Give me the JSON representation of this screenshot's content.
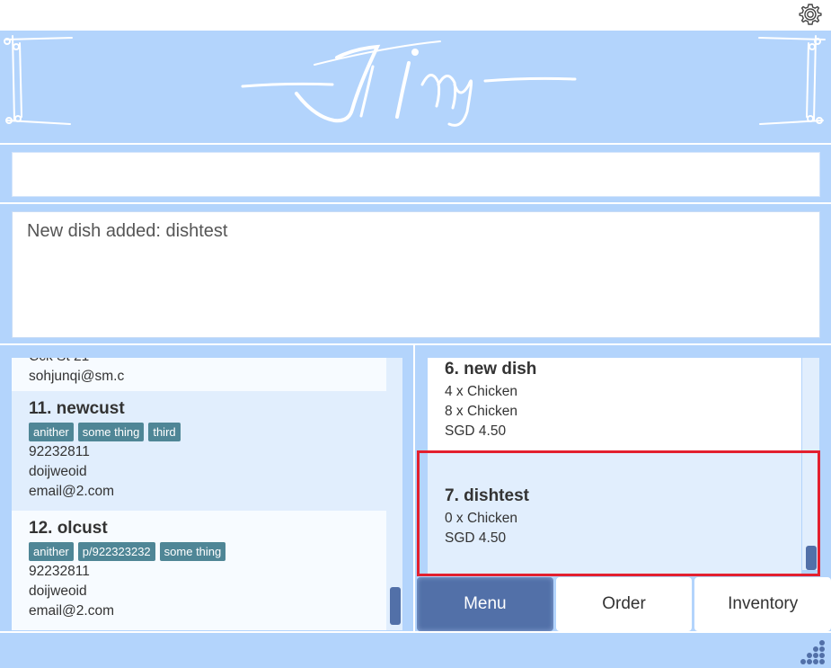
{
  "header": {
    "logo_text": "Jimy"
  },
  "command": {
    "value": ""
  },
  "result": {
    "message": "New dish added: dishtest"
  },
  "customers": {
    "partial_top": {
      "line_cut": "Cck St 21",
      "email": "sohjunqi@sm.c"
    },
    "cards": [
      {
        "title": "11.  newcust",
        "tags": [
          "anither",
          "some thing",
          "third"
        ],
        "phone": "92232811",
        "address": "doijweoid",
        "email": "email@2.com"
      },
      {
        "title": "12.  olcust",
        "tags": [
          "anither",
          "p/922323232",
          "some thing"
        ],
        "phone": "92232811",
        "address": "doijweoid",
        "email": "email@2.com"
      }
    ]
  },
  "dishes": [
    {
      "title": "6.  new dish",
      "ingredients": [
        "4 x Chicken",
        "8 x Chicken"
      ],
      "price": "SGD 4.50"
    },
    {
      "title": "7.  dishtest",
      "ingredients": [
        "0 x Chicken"
      ],
      "price": "SGD 4.50"
    }
  ],
  "tabs": [
    {
      "label": "Menu",
      "active": true
    },
    {
      "label": "Order",
      "active": false
    },
    {
      "label": "Inventory",
      "active": false
    }
  ],
  "colors": {
    "background": "#b3d4fc",
    "accent": "#5270a8",
    "tag": "#4f8696",
    "highlight": "#e3202f",
    "selected_card": "#e1eefd"
  },
  "icons": {
    "settings": "gear-icon",
    "resize": "resize-grip-icon"
  }
}
